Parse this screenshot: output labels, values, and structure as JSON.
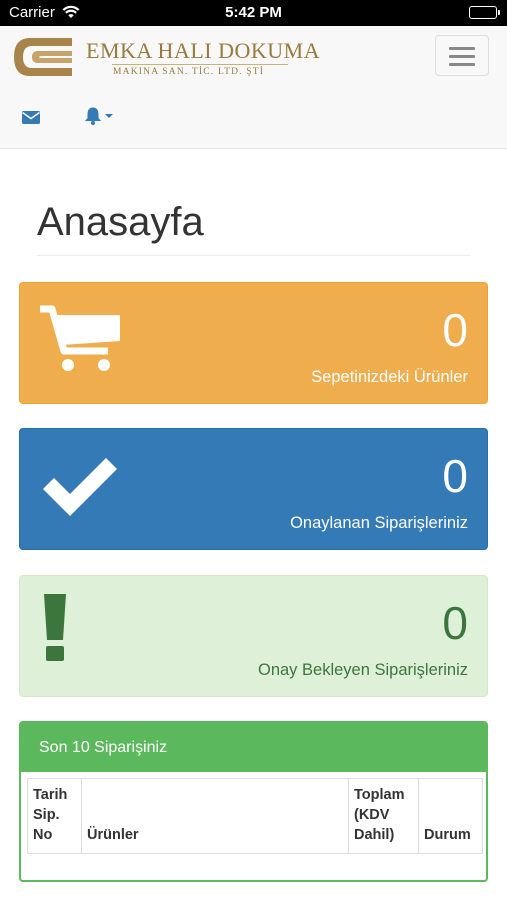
{
  "status_bar": {
    "carrier": "Carrier",
    "time": "5:42 PM"
  },
  "brand": {
    "name": "EMKA HALI DOKUMA",
    "subtitle": "MAKINA SAN. TİC. LTD. ŞTİ"
  },
  "icons": {
    "mail": "envelope-icon",
    "notifications": "bell-icon",
    "menu": "hamburger-icon",
    "cart": "shopping-cart-icon",
    "approved": "check-icon",
    "pending": "exclamation-icon"
  },
  "colors": {
    "warning": "#f0ad4e",
    "primary": "#337ab7",
    "success_light": "#dff0d8",
    "success_text": "#3c763d",
    "success": "#5cb85c",
    "brand_gold": "#9a7a3e"
  },
  "main": {
    "title": "Anasayfa",
    "panels": [
      {
        "value": "0",
        "label": "Sepetinizdeki Ürünler"
      },
      {
        "value": "0",
        "label": "Onaylanan Siparişleriniz"
      },
      {
        "value": "0",
        "label": "Onay Bekleyen Siparişleriniz"
      }
    ],
    "orders": {
      "heading": "Son 10 Siparişiniz",
      "columns": [
        "Tarih Sip. No",
        "Ürünler",
        "Toplam (KDV Dahil)",
        "Durum"
      ],
      "rows": []
    }
  }
}
